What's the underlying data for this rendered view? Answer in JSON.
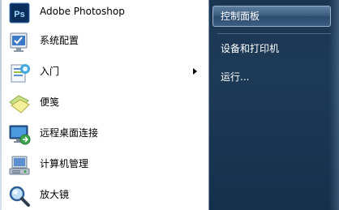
{
  "programs": [
    {
      "label": "Adobe Photoshop",
      "icon": "photoshop-icon",
      "icon_text": "Ps",
      "submenu": false
    },
    {
      "label": "系统配置",
      "icon": "system-config-icon",
      "submenu": false
    },
    {
      "label": "入门",
      "icon": "getting-started-icon",
      "submenu": true
    },
    {
      "label": "便笺",
      "icon": "sticky-notes-icon",
      "submenu": false
    },
    {
      "label": "远程桌面连接",
      "icon": "remote-desktop-icon",
      "submenu": false
    },
    {
      "label": "计算机管理",
      "icon": "computer-management-icon",
      "submenu": false
    },
    {
      "label": "放大镜",
      "icon": "magnifier-icon",
      "submenu": false
    }
  ],
  "right_links": [
    {
      "label": "控制面板",
      "highlighted": true
    },
    {
      "label": "设备和打印机",
      "highlighted": false
    },
    {
      "label": "运行...",
      "highlighted": false
    }
  ],
  "colors": {
    "right_pane_bg": "#1a3653",
    "photoshop_blue": "#0a2f5c",
    "photoshop_text": "#a5d8ff"
  }
}
